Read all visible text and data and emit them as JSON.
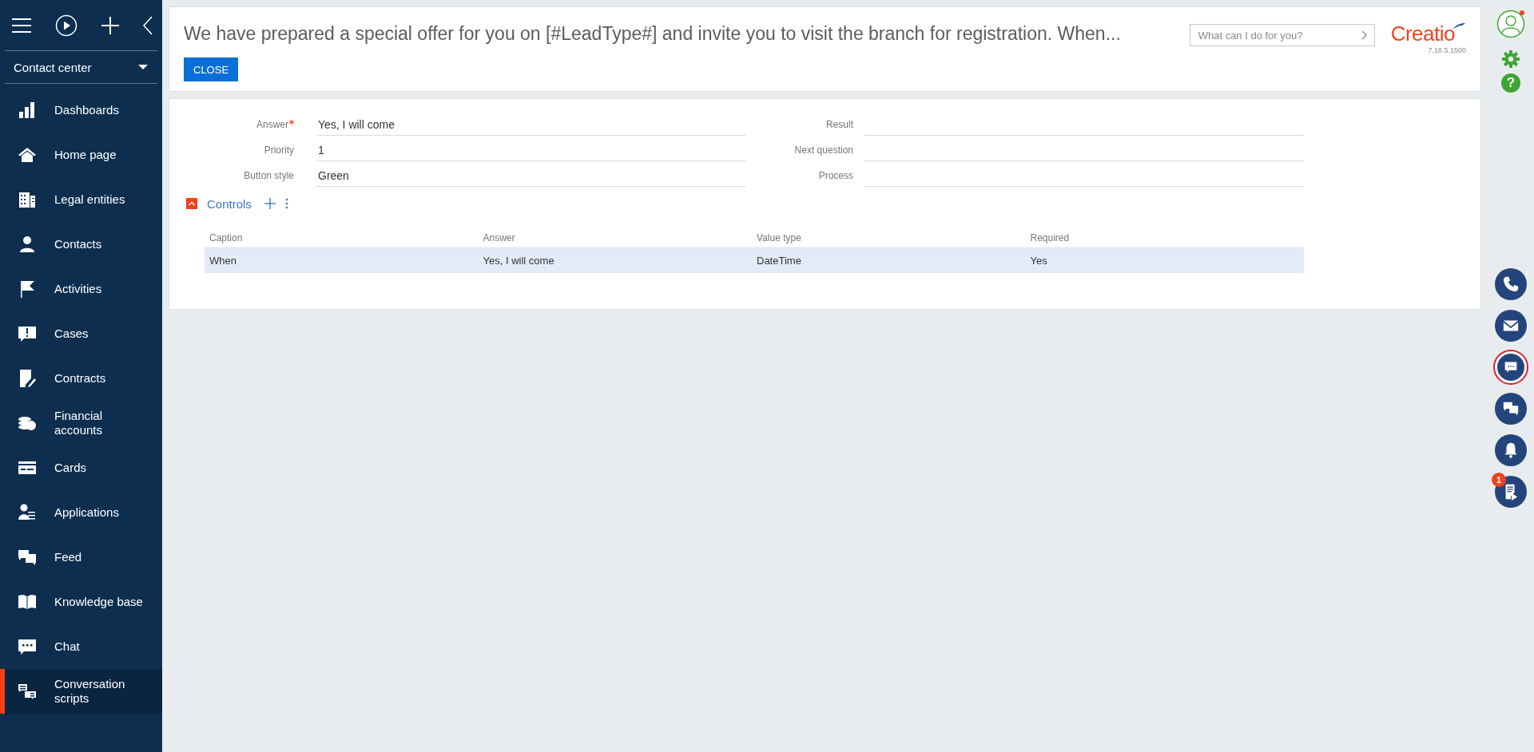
{
  "sidebar": {
    "workplace": "Contact center",
    "items": [
      {
        "label": "Dashboards",
        "selected": false
      },
      {
        "label": "Home page",
        "selected": false
      },
      {
        "label": "Legal entities",
        "selected": false
      },
      {
        "label": "Contacts",
        "selected": false
      },
      {
        "label": "Activities",
        "selected": false
      },
      {
        "label": "Cases",
        "selected": false
      },
      {
        "label": "Contracts",
        "selected": false
      },
      {
        "label": "Financial accounts",
        "selected": false
      },
      {
        "label": "Cards",
        "selected": false
      },
      {
        "label": "Applications",
        "selected": false
      },
      {
        "label": "Feed",
        "selected": false
      },
      {
        "label": "Knowledge base",
        "selected": false
      },
      {
        "label": "Chat",
        "selected": false
      },
      {
        "label": "Conversation scripts",
        "selected": true
      }
    ]
  },
  "header": {
    "title": "We have prepared a special offer for you on [#LeadType#] and invite you to visit the branch for registration. When...",
    "close_button": "CLOSE",
    "search": {
      "placeholder": "What can I do for you?"
    },
    "logo": "Creatio",
    "version": "7.18.5.1500"
  },
  "form": {
    "left_fields": [
      {
        "label": "Answer",
        "required": true,
        "value": "Yes, I will come"
      },
      {
        "label": "Priority",
        "required": false,
        "value": "1"
      },
      {
        "label": "Button style",
        "required": false,
        "value": "Green"
      }
    ],
    "right_fields": [
      {
        "label": "Result"
      },
      {
        "label": "Next question"
      },
      {
        "label": "Process"
      }
    ]
  },
  "controls": {
    "title": "Controls",
    "expanded": true,
    "table": {
      "columns": [
        "Caption",
        "Answer",
        "Value type",
        "Required"
      ],
      "rows": [
        {
          "cells": [
            "When",
            "Yes, I will come",
            "DateTime",
            "Yes"
          ],
          "selected": true
        }
      ]
    }
  },
  "right_bar": {
    "help": "?",
    "comm": [
      {
        "selected": false
      },
      {
        "selected": false
      },
      {
        "selected": true
      },
      {
        "selected": false
      },
      {
        "selected": false
      },
      {
        "selected": false,
        "badge": "1"
      }
    ]
  }
}
